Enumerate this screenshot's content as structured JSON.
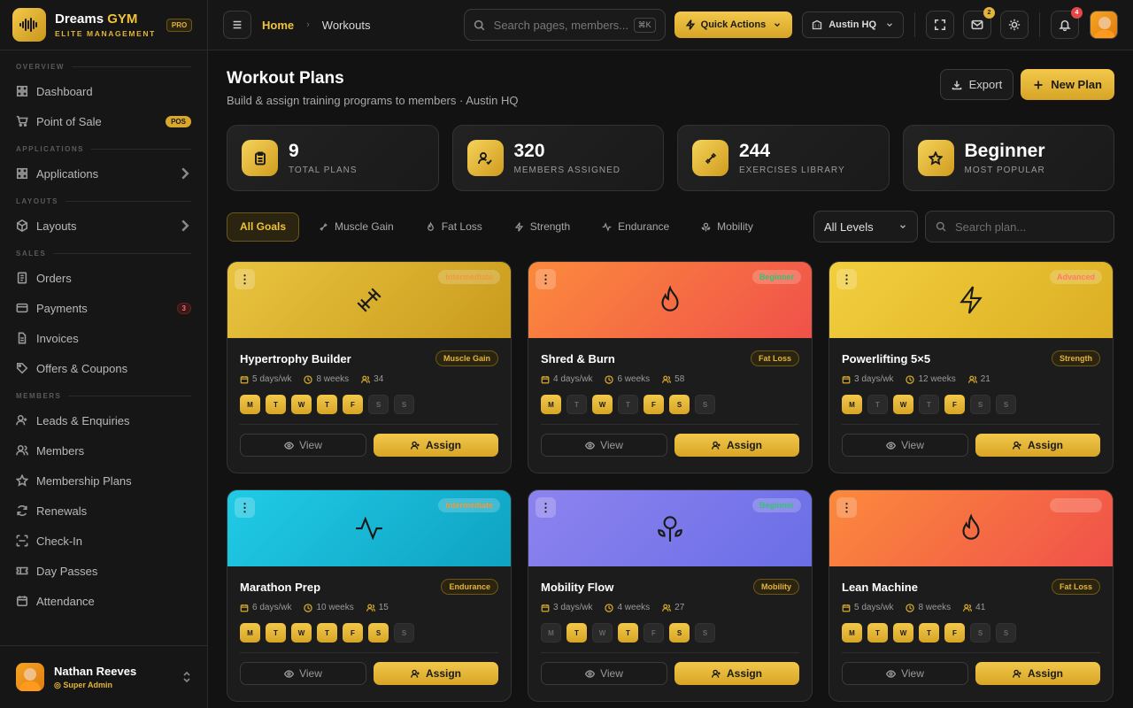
{
  "brand": {
    "name_a": "Dreams",
    "name_b": "GYM",
    "subtitle": "ELITE MANAGEMENT",
    "badge": "PRO"
  },
  "sidebar": {
    "sections": {
      "overview": "OVERVIEW",
      "applications": "APPLICATIONS",
      "layouts": "LAYOUTS",
      "sales": "SALES",
      "members": "MEMBERS"
    },
    "items": {
      "dashboard": "Dashboard",
      "pos": "Point of Sale",
      "pos_badge": "POS",
      "applications": "Applications",
      "layouts": "Layouts",
      "orders": "Orders",
      "payments": "Payments",
      "payments_badge": "3",
      "invoices": "Invoices",
      "offers": "Offers & Coupons",
      "leads": "Leads & Enquiries",
      "members": "Members",
      "membership_plans": "Membership Plans",
      "renewals": "Renewals",
      "checkin": "Check-In",
      "day_passes": "Day Passes",
      "attendance": "Attendance"
    },
    "user": {
      "name": "Nathan Reeves",
      "role": "Super Admin"
    }
  },
  "topbar": {
    "breadcrumb_home": "Home",
    "breadcrumb_sep": "›",
    "breadcrumb_current": "Workouts",
    "search_placeholder": "Search pages, members...",
    "search_shortcut": "⌘K",
    "quick_actions": "Quick Actions",
    "location": "Austin HQ",
    "mail_count": "2",
    "notif_count": "4"
  },
  "page": {
    "title": "Workout Plans",
    "subtitle": "Build & assign training programs to members · Austin HQ",
    "export": "Export",
    "new_plan": "New Plan"
  },
  "stats": [
    {
      "value": "9",
      "label": "TOTAL PLANS",
      "icon": "clipboard-icon"
    },
    {
      "value": "320",
      "label": "MEMBERS ASSIGNED",
      "icon": "user-check-icon"
    },
    {
      "value": "244",
      "label": "EXERCISES LIBRARY",
      "icon": "dumbbell-icon"
    },
    {
      "value": "Beginner",
      "label": "MOST POPULAR",
      "icon": "star-icon"
    }
  ],
  "filters": {
    "tabs": [
      "All Goals",
      "Muscle Gain",
      "Fat Loss",
      "Strength",
      "Endurance",
      "Mobility"
    ],
    "level_select": "All Levels",
    "search_placeholder": "Search plan..."
  },
  "cards": [
    {
      "name": "Hypertrophy Builder",
      "category": "Muscle Gain",
      "level": "Intermediate",
      "days": "5 days/wk",
      "weeks": "8 weeks",
      "members": "34",
      "schedule": [
        1,
        1,
        1,
        1,
        1,
        0,
        0
      ]
    },
    {
      "name": "Shred & Burn",
      "category": "Fat Loss",
      "level": "Beginner",
      "days": "4 days/wk",
      "weeks": "6 weeks",
      "members": "58",
      "schedule": [
        1,
        0,
        1,
        0,
        1,
        1,
        0
      ]
    },
    {
      "name": "Powerlifting 5×5",
      "category": "Strength",
      "level": "Advanced",
      "days": "3 days/wk",
      "weeks": "12 weeks",
      "members": "21",
      "schedule": [
        1,
        0,
        1,
        0,
        1,
        0,
        0
      ]
    },
    {
      "name": "Marathon Prep",
      "category": "Endurance",
      "level": "Intermediate",
      "days": "6 days/wk",
      "weeks": "10 weeks",
      "members": "15",
      "schedule": [
        1,
        1,
        1,
        1,
        1,
        1,
        0
      ]
    },
    {
      "name": "Mobility Flow",
      "category": "Mobility",
      "level": "Beginner",
      "days": "3 days/wk",
      "weeks": "4 weeks",
      "members": "27",
      "schedule": [
        0,
        1,
        0,
        1,
        0,
        1,
        0
      ]
    },
    {
      "name": "Lean Machine",
      "category": "Fat Loss",
      "level": "Advanced",
      "days": "5 days/wk",
      "weeks": "8 weeks",
      "members": "41",
      "schedule": [
        1,
        1,
        1,
        1,
        1,
        0,
        0
      ]
    }
  ],
  "day_letters": [
    "M",
    "T",
    "W",
    "T",
    "F",
    "S",
    "S"
  ],
  "card_actions": {
    "view": "View",
    "assign": "Assign"
  },
  "colors": {
    "accent": "#f0c33c",
    "background": "#121212",
    "danger": "#e34848"
  }
}
